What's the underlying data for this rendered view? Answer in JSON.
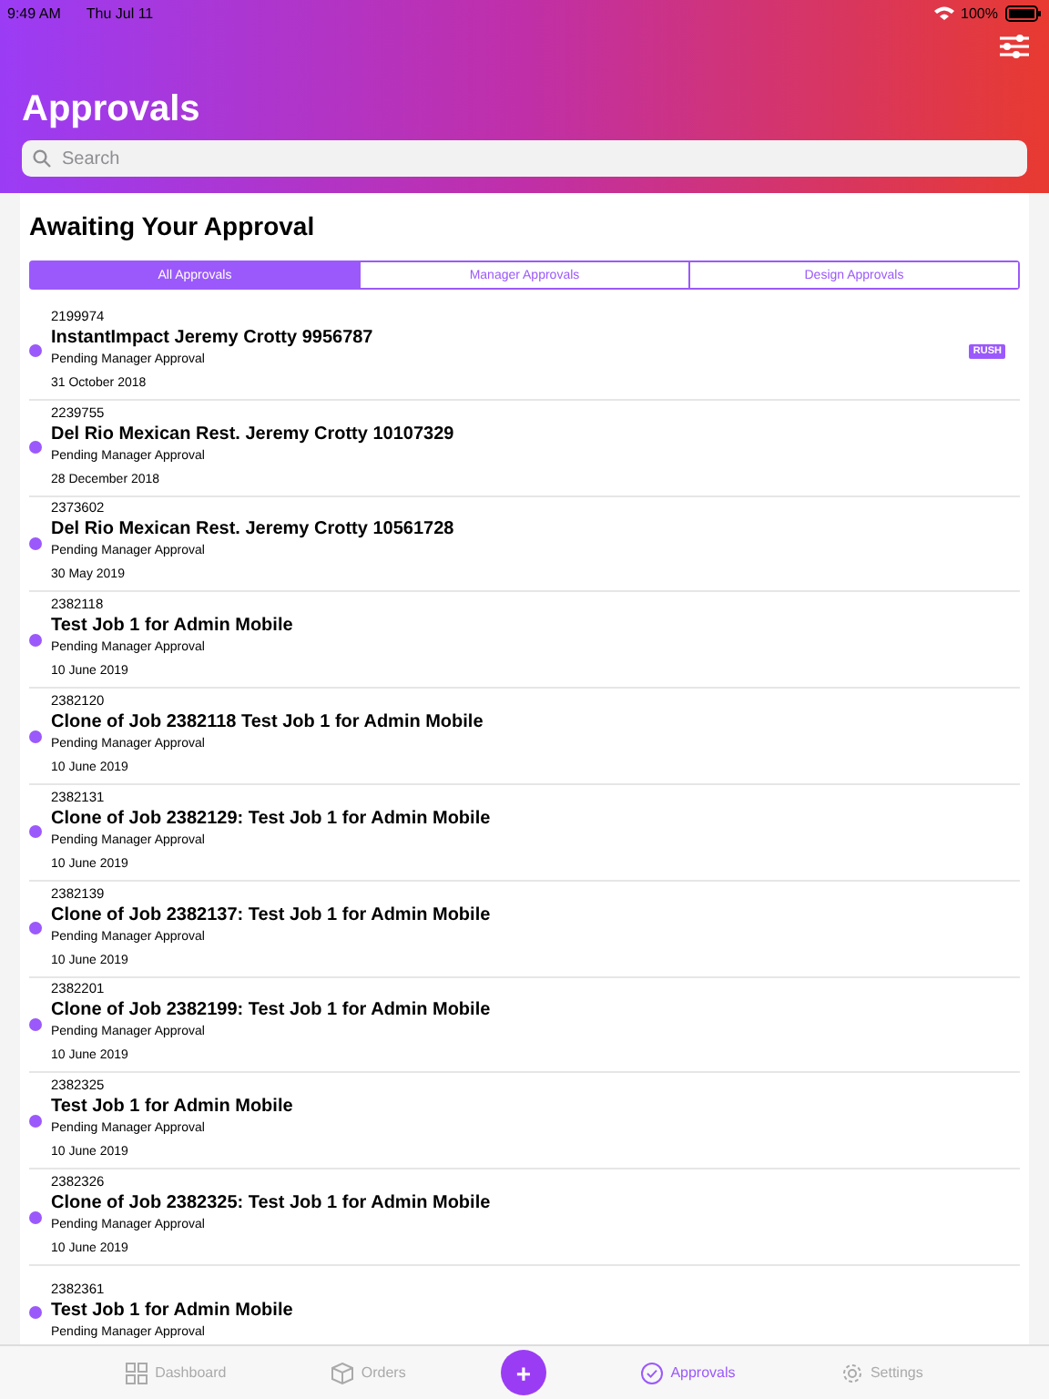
{
  "status_bar": {
    "time": "9:49 AM",
    "date": "Thu Jul 11",
    "battery": "100%"
  },
  "header": {
    "title": "Approvals",
    "search": {
      "placeholder": "Search"
    }
  },
  "section": {
    "title": "Awaiting Your Approval"
  },
  "segments": [
    {
      "label": "All Approvals",
      "selected": true
    },
    {
      "label": "Manager Approvals",
      "selected": false
    },
    {
      "label": "Design Approvals",
      "selected": false
    }
  ],
  "jobs": [
    {
      "number": "2199974",
      "title": "InstantImpact Jeremy Crotty 9956787",
      "status": "Pending Manager Approval",
      "date": "31 October 2018",
      "badge": "RUSH"
    },
    {
      "number": "2239755",
      "title": "Del Rio Mexican Rest. Jeremy Crotty 10107329",
      "status": "Pending Manager Approval",
      "date": "28 December 2018"
    },
    {
      "number": "2373602",
      "title": "Del Rio Mexican Rest. Jeremy Crotty 10561728",
      "status": "Pending Manager Approval",
      "date": "30 May 2019"
    },
    {
      "number": "2382118",
      "title": "Test Job 1 for Admin Mobile",
      "status": "Pending Manager Approval",
      "date": "10 June 2019"
    },
    {
      "number": "2382120",
      "title": "Clone of Job 2382118 Test Job 1 for Admin Mobile",
      "status": "Pending Manager Approval",
      "date": "10 June 2019"
    },
    {
      "number": "2382131",
      "title": "Clone of Job 2382129: Test Job 1 for Admin Mobile",
      "status": "Pending Manager Approval",
      "date": "10 June 2019"
    },
    {
      "number": "2382139",
      "title": "Clone of Job 2382137: Test Job 1 for Admin Mobile",
      "status": "Pending Manager Approval",
      "date": "10 June 2019"
    },
    {
      "number": "2382201",
      "title": "Clone of Job 2382199: Test Job 1 for Admin Mobile",
      "status": "Pending Manager Approval",
      "date": "10 June 2019"
    },
    {
      "number": "2382325",
      "title": "Test Job 1 for Admin Mobile",
      "status": "Pending Manager Approval",
      "date": "10 June 2019"
    },
    {
      "number": "2382326",
      "title": "Clone of Job 2382325: Test Job 1 for Admin Mobile",
      "status": "Pending Manager Approval",
      "date": "10 June 2019"
    },
    {
      "number": "2382361",
      "title": "Test Job 1 for Admin Mobile",
      "status": "Pending Manager Approval"
    }
  ],
  "tab_bar": {
    "items": [
      {
        "label": "Dashboard",
        "kind": "dashboard",
        "selected": false
      },
      {
        "label": "Orders",
        "kind": "orders",
        "selected": false
      },
      {
        "label": "+",
        "kind": "add"
      },
      {
        "label": "Approvals",
        "kind": "approvals",
        "selected": true
      },
      {
        "label": "Settings",
        "kind": "settings",
        "selected": false
      }
    ]
  }
}
